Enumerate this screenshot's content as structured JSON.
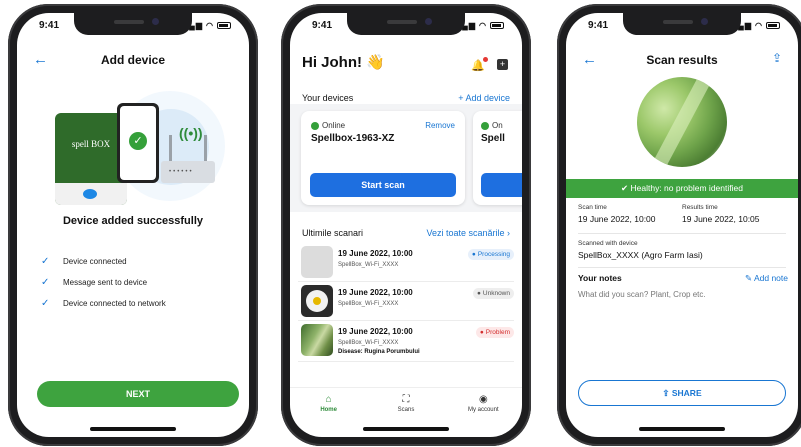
{
  "status_time": "9:41",
  "screen1": {
    "title": "Add device",
    "device_box_label": "spell BOX",
    "success_message": "Device added successfully",
    "checklist": [
      "Device connected",
      "Message sent to device",
      "Device connected to network"
    ],
    "next_label": "NEXT"
  },
  "screen2": {
    "greeting": "Hi John! 👋",
    "your_devices_label": "Your devices",
    "add_device_label": "+ Add device",
    "device_card": {
      "status": "Online",
      "remove_label": "Remove",
      "name": "Spellbox-1963-XZ",
      "start_scan_label": "Start scan"
    },
    "device_card2": {
      "status": "On",
      "name": "Spell"
    },
    "recent_scans_label": "Ultimile scanari",
    "see_all_label": "Vezi toate scanările ›",
    "scans": [
      {
        "date": "19 June 2022, 10:00",
        "device": "SpellBox_Wi-Fi_XXXX",
        "status": "Processing",
        "disease": ""
      },
      {
        "date": "19 June 2022, 10:00",
        "device": "SpellBox_Wi-Fi_XXXX",
        "status": "Unknown",
        "disease": ""
      },
      {
        "date": "19 June 2022, 10:00",
        "device": "SpellBox_Wi-Fi_XXXX",
        "status": "Problem",
        "disease": "Disease: Rugina Porumbului"
      }
    ],
    "nav": {
      "home": "Home",
      "scans": "Scans",
      "account": "My account"
    }
  },
  "screen3": {
    "title": "Scan results",
    "healthy_banner": "Healthy: no problem identified",
    "scan_time_label": "Scan time",
    "scan_time_value": "19 June 2022, 10:00",
    "results_time_label": "Results time",
    "results_time_value": "19 June 2022, 10:05",
    "scanned_with_label": "Scanned with device",
    "scanned_with_value": "SpellBox_XXXX (Agro Farm Iasi)",
    "notes_label": "Your notes",
    "add_note_label": "Add note",
    "notes_placeholder": "What did you scan? Plant, Crop etc.",
    "share_label": "SHARE"
  },
  "colors": {
    "accent_blue": "#1976d2",
    "accent_green": "#3ea33f",
    "problem_red": "#d32f2f"
  }
}
